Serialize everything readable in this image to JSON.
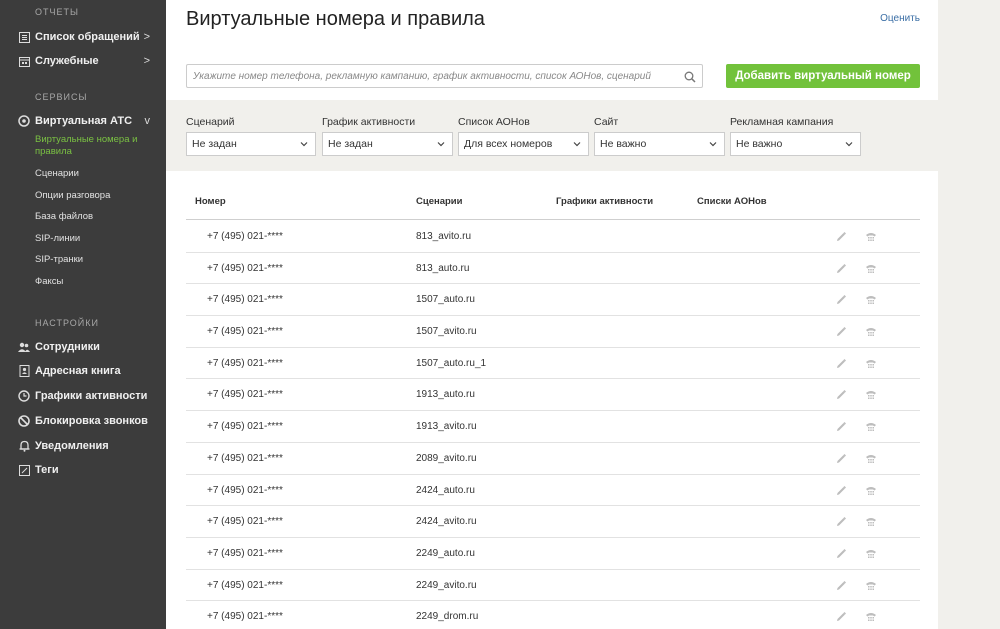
{
  "sidebar": {
    "reports_heading": "ОТЧЕТЫ",
    "reports": [
      {
        "label": "Список обращений",
        "arrow": ">",
        "icon": "list-icon"
      },
      {
        "label": "Служебные",
        "arrow": ">",
        "icon": "calendar-icon"
      }
    ],
    "services_heading": "СЕРВИСЫ",
    "virtual_pbx": {
      "label": "Виртуальная АТС",
      "arrow": "v",
      "icon": "pbx-icon"
    },
    "virtual_pbx_items": [
      {
        "label": "Виртуальные номера и правила",
        "active": true
      },
      {
        "label": "Сценарии"
      },
      {
        "label": "Опции разговора"
      },
      {
        "label": "База файлов"
      },
      {
        "label": "SIP-линии"
      },
      {
        "label": "SIP-транки"
      },
      {
        "label": "Факсы"
      }
    ],
    "settings_heading": "НАСТРОЙКИ",
    "settings": [
      {
        "label": "Сотрудники",
        "icon": "users-icon"
      },
      {
        "label": "Адресная книга",
        "icon": "address-book-icon"
      },
      {
        "label": "Графики активности",
        "icon": "clock-icon"
      },
      {
        "label": "Блокировка звонков",
        "icon": "block-icon"
      },
      {
        "label": "Уведомления",
        "icon": "bell-icon"
      },
      {
        "label": "Теги",
        "icon": "tag-icon"
      }
    ],
    "accent_color": "#7ac143"
  },
  "header": {
    "title": "Виртуальные номера и правила",
    "rate_link": "Оценить"
  },
  "search": {
    "placeholder": "Укажите номер телефона, рекламную кампанию, график активности, список АОНов, сценарий",
    "value": ""
  },
  "add_button": {
    "label": "Добавить виртуальный номер",
    "color": "#72c23b"
  },
  "filters": [
    {
      "label": "Сценарий",
      "value": "Не задан"
    },
    {
      "label": "График активности",
      "value": "Не задан"
    },
    {
      "label": "Список АОНов",
      "value": "Для всех номеров"
    },
    {
      "label": "Сайт",
      "value": "Не важно"
    },
    {
      "label": "Рекламная кампания",
      "value": "Не важно"
    }
  ],
  "table": {
    "columns": [
      "Номер",
      "Сценарии",
      "Графики активности",
      "Списки АОНов"
    ],
    "rows": [
      {
        "number": "+7 (495) 021-****",
        "scenario": "813_avito.ru"
      },
      {
        "number": "+7 (495) 021-****",
        "scenario": "813_auto.ru"
      },
      {
        "number": "+7 (495) 021-****",
        "scenario": "1507_auto.ru"
      },
      {
        "number": "+7 (495) 021-****",
        "scenario": "1507_avito.ru"
      },
      {
        "number": "+7 (495) 021-****",
        "scenario": "1507_auto.ru_1"
      },
      {
        "number": "+7 (495) 021-****",
        "scenario": "1913_auto.ru"
      },
      {
        "number": "+7 (495) 021-****",
        "scenario": "1913_avito.ru"
      },
      {
        "number": "+7 (495) 021-****",
        "scenario": "2089_avito.ru"
      },
      {
        "number": "+7 (495) 021-****",
        "scenario": "2424_auto.ru"
      },
      {
        "number": "+7 (495) 021-****",
        "scenario": "2424_avito.ru"
      },
      {
        "number": "+7 (495) 021-****",
        "scenario": "2249_auto.ru"
      },
      {
        "number": "+7 (495) 021-****",
        "scenario": "2249_avito.ru"
      },
      {
        "number": "+7 (495) 021-****",
        "scenario": "2249_drom.ru"
      }
    ]
  }
}
